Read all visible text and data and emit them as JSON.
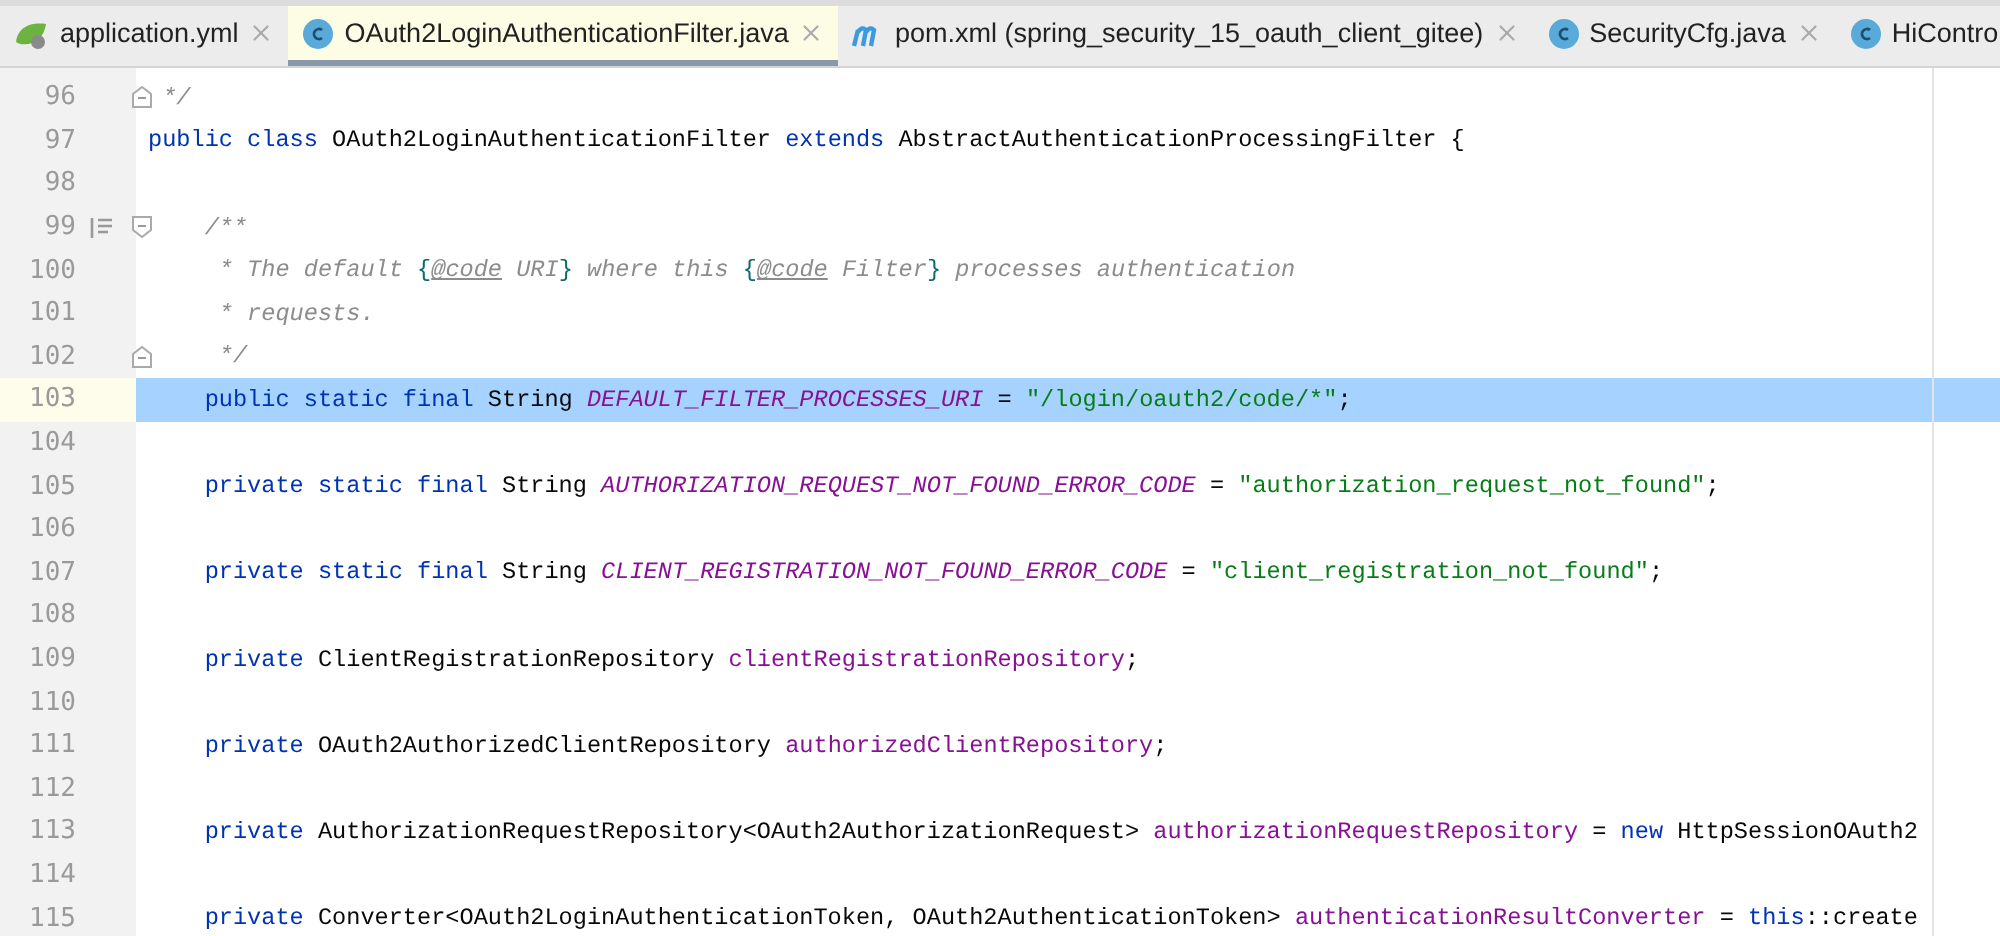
{
  "tabs": [
    {
      "label": "application.yml",
      "kind": "spring",
      "selected": false
    },
    {
      "label": "OAuth2LoginAuthenticationFilter.java",
      "kind": "class",
      "selected": true
    },
    {
      "label": "pom.xml (spring_security_15_oauth_client_gitee)",
      "kind": "maven",
      "selected": false
    },
    {
      "label": "SecurityCfg.java",
      "kind": "class",
      "selected": false
    },
    {
      "label": "HiContro",
      "kind": "class",
      "selected": false
    }
  ],
  "lines": [
    {
      "number": "96",
      "fold_end": true,
      "selected": false,
      "tokens": [
        {
          "kind": "comment",
          "text": " */"
        }
      ]
    },
    {
      "number": "97",
      "selected": false,
      "tokens": [
        {
          "kind": "keyword",
          "text": "public class "
        },
        {
          "kind": "plain",
          "text": "OAuth2LoginAuthenticationFilter "
        },
        {
          "kind": "keyword",
          "text": "extends "
        },
        {
          "kind": "plain",
          "text": "AbstractAuthenticationProcessingFilter {"
        }
      ]
    },
    {
      "number": "98",
      "selected": false
    },
    {
      "number": "99",
      "fold_start": true,
      "doc_toggle": true,
      "selected": false,
      "tokens": [
        {
          "kind": "comment",
          "text": "    /**"
        }
      ]
    },
    {
      "number": "100",
      "selected": false,
      "tokens": [
        {
          "kind": "comment",
          "text": "     * The default "
        },
        {
          "kind": "brace",
          "text": "{"
        },
        {
          "kind": "tag",
          "text": "@code"
        },
        {
          "kind": "comment",
          "text": " URI"
        },
        {
          "kind": "brace",
          "text": "}"
        },
        {
          "kind": "comment",
          "text": " where this "
        },
        {
          "kind": "brace",
          "text": "{"
        },
        {
          "kind": "tag",
          "text": "@code"
        },
        {
          "kind": "comment",
          "text": " Filter"
        },
        {
          "kind": "brace",
          "text": "}"
        },
        {
          "kind": "comment",
          "text": " processes authentication"
        }
      ]
    },
    {
      "number": "101",
      "selected": false,
      "tokens": [
        {
          "kind": "comment",
          "text": "     * requests."
        }
      ]
    },
    {
      "number": "102",
      "fold_end": true,
      "selected": false,
      "tokens": [
        {
          "kind": "comment",
          "text": "     */"
        }
      ]
    },
    {
      "number": "103",
      "selected": true,
      "tokens": [
        {
          "kind": "keyword",
          "text": "    public static final "
        },
        {
          "kind": "plain",
          "text": "String "
        },
        {
          "kind": "constant",
          "text": "DEFAULT_FILTER_PROCESSES_URI"
        },
        {
          "kind": "plain",
          "text": " = "
        },
        {
          "kind": "string",
          "text": "\"/login/oauth2/code/*\""
        },
        {
          "kind": "plain",
          "text": ";"
        }
      ]
    },
    {
      "number": "104",
      "selected": false
    },
    {
      "number": "105",
      "selected": false,
      "tokens": [
        {
          "kind": "keyword",
          "text": "    private static final "
        },
        {
          "kind": "plain",
          "text": "String "
        },
        {
          "kind": "constant",
          "text": "AUTHORIZATION_REQUEST_NOT_FOUND_ERROR_CODE"
        },
        {
          "kind": "plain",
          "text": " = "
        },
        {
          "kind": "string",
          "text": "\"authorization_request_not_found\""
        },
        {
          "kind": "plain",
          "text": ";"
        }
      ]
    },
    {
      "number": "106",
      "selected": false
    },
    {
      "number": "107",
      "selected": false,
      "tokens": [
        {
          "kind": "keyword",
          "text": "    private static final "
        },
        {
          "kind": "plain",
          "text": "String "
        },
        {
          "kind": "constant",
          "text": "CLIENT_REGISTRATION_NOT_FOUND_ERROR_CODE"
        },
        {
          "kind": "plain",
          "text": " = "
        },
        {
          "kind": "string",
          "text": "\"client_registration_not_found\""
        },
        {
          "kind": "plain",
          "text": ";"
        }
      ]
    },
    {
      "number": "108",
      "selected": false
    },
    {
      "number": "109",
      "selected": false,
      "tokens": [
        {
          "kind": "keyword",
          "text": "    private "
        },
        {
          "kind": "plain",
          "text": "ClientRegistrationRepository "
        },
        {
          "kind": "field",
          "text": "clientRegistrationRepository"
        },
        {
          "kind": "plain",
          "text": ";"
        }
      ]
    },
    {
      "number": "110",
      "selected": false
    },
    {
      "number": "111",
      "selected": false,
      "tokens": [
        {
          "kind": "keyword",
          "text": "    private "
        },
        {
          "kind": "plain",
          "text": "OAuth2AuthorizedClientRepository "
        },
        {
          "kind": "field",
          "text": "authorizedClientRepository"
        },
        {
          "kind": "plain",
          "text": ";"
        }
      ]
    },
    {
      "number": "112",
      "selected": false
    },
    {
      "number": "113",
      "selected": false,
      "tokens": [
        {
          "kind": "keyword",
          "text": "    private "
        },
        {
          "kind": "plain",
          "text": "AuthorizationRequestRepository<OAuth2AuthorizationRequest> "
        },
        {
          "kind": "field",
          "text": "authorizationRequestRepository"
        },
        {
          "kind": "plain",
          "text": " = "
        },
        {
          "kind": "keyword",
          "text": "new "
        },
        {
          "kind": "plain",
          "text": "HttpSessionOAuth2"
        }
      ]
    },
    {
      "number": "114",
      "selected": false
    },
    {
      "number": "115",
      "selected": false,
      "tokens": [
        {
          "kind": "keyword",
          "text": "    private "
        },
        {
          "kind": "plain",
          "text": "Converter<OAuth2LoginAuthenticationToken, OAuth2AuthenticationToken> "
        },
        {
          "kind": "field",
          "text": "authenticationResultConverter"
        },
        {
          "kind": "plain",
          "text": " = "
        },
        {
          "kind": "keyword",
          "text": "this"
        },
        {
          "kind": "plain",
          "text": "::create"
        }
      ]
    }
  ]
}
